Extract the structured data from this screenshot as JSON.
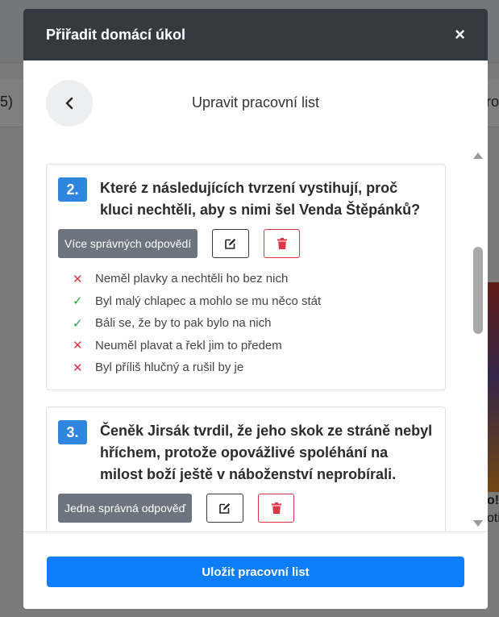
{
  "background": {
    "left_fragment": "5)",
    "right_fragment": "rod",
    "right_small_1": "o!",
    "right_small_2": "oti"
  },
  "modal": {
    "title": "Přiřadit domácí úkol",
    "close_glyph": "×",
    "subtitle": "Upravit pracovní list",
    "save_label": "Uložit pracovní list"
  },
  "questions": [
    {
      "number": "2.",
      "text": "Které z následujících tvrzení vystihují, proč kluci nechtěli, aby s nimi šel Venda Štěpánků?",
      "type_label": "Více správných odpovědí",
      "answers": [
        {
          "text": "Neměl plavky a nechtěli ho bez nich",
          "correct": false
        },
        {
          "text": "Byl malý chlapec a mohlo se mu něco stát",
          "correct": true
        },
        {
          "text": "Báli se, že by to pak bylo na nich",
          "correct": true
        },
        {
          "text": "Neuměl plavat a řekl jim to předem",
          "correct": false
        },
        {
          "text": "Byl příliš hlučný a rušil by je",
          "correct": false
        }
      ]
    },
    {
      "number": "3.",
      "text": "Čeněk Jirsák tvrdil, že jeho skok ze stráně nebyl hříchem, protože opovážlivé spoléhání na milost boží ještě v náboženství neprobírali.",
      "type_label": "Jedna správná odpověď"
    }
  ],
  "icons": {
    "back": "chevron-left-icon",
    "edit": "edit-icon",
    "delete": "trash-icon",
    "correct": "check-icon",
    "wrong": "x-icon"
  },
  "colors": {
    "header_bg": "#343a40",
    "number_badge": "#2e86de",
    "type_badge": "#6c757d",
    "correct": "#28a745",
    "wrong": "#dc3545",
    "primary": "#0d7ef7"
  }
}
